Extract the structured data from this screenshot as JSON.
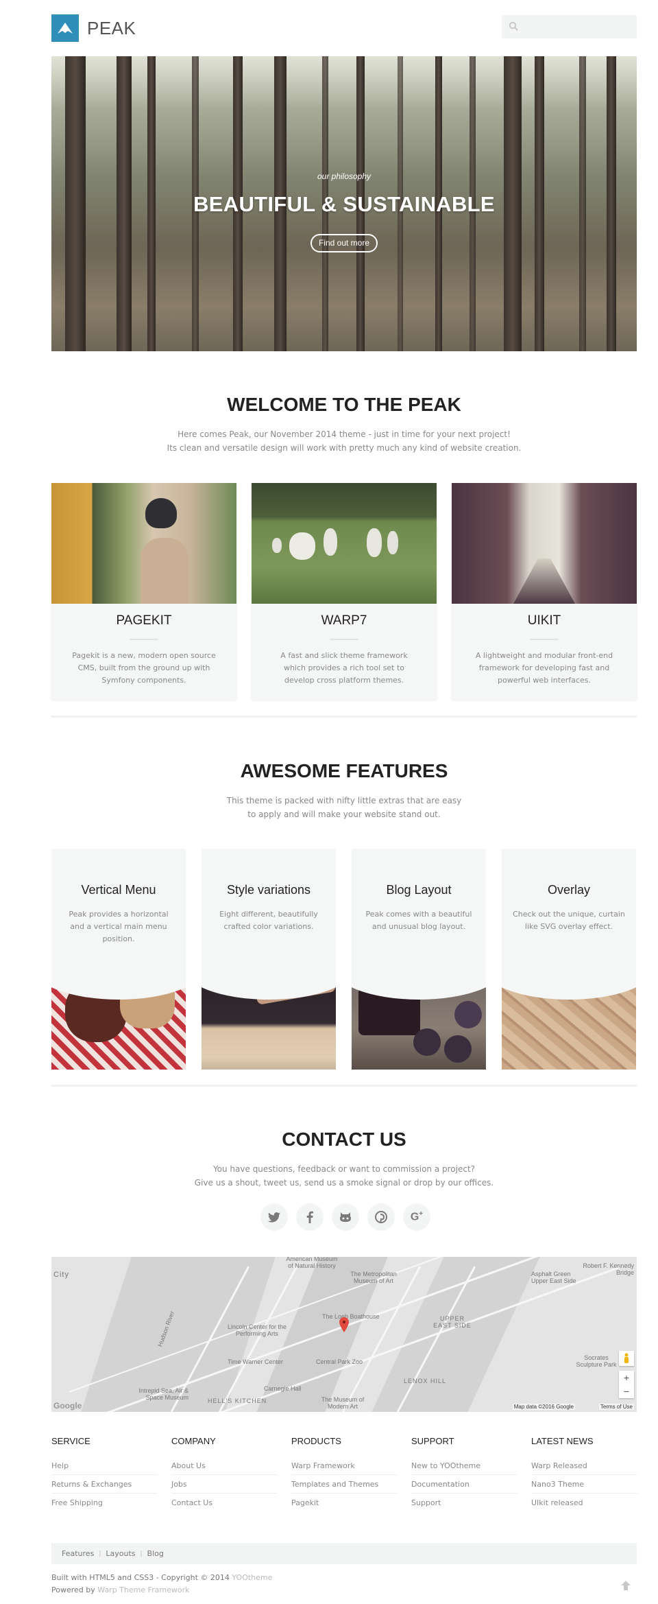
{
  "header": {
    "logo_text": "PEAK",
    "search_placeholder": ""
  },
  "hero": {
    "subtitle": "our philosophy",
    "title": "BEAUTIFUL & SUSTAINABLE",
    "button_label": "Find out more"
  },
  "welcome": {
    "title": "WELCOME TO THE PEAK",
    "line1": "Here comes Peak, our November 2014 theme - just in time for your next project!",
    "line2": "Its clean and versatile design will work with pretty much any kind of website creation.",
    "cards": [
      {
        "title": "PAGEKIT",
        "text": "Pagekit is a new, modern open source CMS, built from the ground up with Symfony components."
      },
      {
        "title": "WARP7",
        "text": "A fast and slick theme framework which provides a rich tool set to develop cross platform themes."
      },
      {
        "title": "UIKIT",
        "text": "A lightweight and modular front-end framework for developing fast and powerful web interfaces."
      }
    ]
  },
  "features": {
    "title": "AWESOME FEATURES",
    "line1": "This theme is packed with nifty little extras that are easy",
    "line2": "to apply and will make your website stand out.",
    "cards": [
      {
        "title": "Vertical Menu",
        "text": "Peak provides a horizontal and a vertical main menu position."
      },
      {
        "title": "Style variations",
        "text": "Eight different, beautifully crafted color variations."
      },
      {
        "title": "Blog Layout",
        "text": "Peak comes with a beautiful and unusual blog layout."
      },
      {
        "title": "Overlay",
        "text": "Check out the unique, curtain like SVG overlay effect."
      }
    ]
  },
  "contact": {
    "title": "CONTACT US",
    "line1": "You have questions, feedback or want to commission a project?",
    "line2": "Give us a shout, tweet us, send us a smoke signal or drop by our offices.",
    "social": [
      {
        "icon": "twitter-icon",
        "glyph": "🐦"
      },
      {
        "icon": "facebook-icon",
        "glyph": "f"
      },
      {
        "icon": "github-icon",
        "glyph": "◙"
      },
      {
        "icon": "pinterest-icon",
        "glyph": "℗"
      },
      {
        "icon": "google-plus-icon",
        "glyph": "G+"
      }
    ]
  },
  "map": {
    "labels": {
      "amnh": "American Museum of Natural History",
      "met": "The Metropolitan Museum of Art",
      "boathouse": "The Loeb Boathouse",
      "lincoln": "Lincoln Center for the Performing Arts",
      "twc": "Time Warner Center",
      "central_park": "Central Park Zoo",
      "carnegie": "Carnegie Hall",
      "moma": "The Museum of Modern Art",
      "hells_kitchen": "HELL'S KITCHEN",
      "intrepid": "Intrepid Sea, Air & Space Museum",
      "ues": "UPPER EAST SIDE",
      "lenox": "LENOX HILL",
      "asphalt": "Asphalt Green Upper East Side",
      "rfk": "Robert F. Kennedy Bridge",
      "socrates": "Socrates Sculpture Park",
      "city": "City",
      "hudson": "Hudson River",
      "google": "Google"
    },
    "attribution": "Map data ©2016 Google",
    "terms": "Terms of Use",
    "zoom_in": "+",
    "zoom_out": "−"
  },
  "footer": {
    "columns": [
      {
        "title": "SERVICE",
        "links": [
          "Help",
          "Returns & Exchanges",
          "Free Shipping"
        ]
      },
      {
        "title": "COMPANY",
        "links": [
          "About Us",
          "Jobs",
          "Contact Us"
        ]
      },
      {
        "title": "PRODUCTS",
        "links": [
          "Warp Framework",
          "Templates and Themes",
          "Pagekit"
        ]
      },
      {
        "title": "SUPPORT",
        "links": [
          "New to YOOtheme",
          "Documentation",
          "Support"
        ]
      },
      {
        "title": "LATEST NEWS",
        "links": [
          "Warp Released",
          "Nano3 Theme",
          "UIkit released"
        ]
      }
    ],
    "bottom_nav": [
      "Features",
      "Layouts",
      "Blog"
    ],
    "copyright_text": "Built with HTML5 and CSS3 - Copyright © 2014 ",
    "copyright_link": "YOOtheme",
    "powered_text": "Powered by ",
    "powered_link": "Warp Theme Framework"
  },
  "colors": {
    "brand": "#2f8fb8",
    "panel": "#f5f7f7",
    "text_muted": "#888888"
  }
}
